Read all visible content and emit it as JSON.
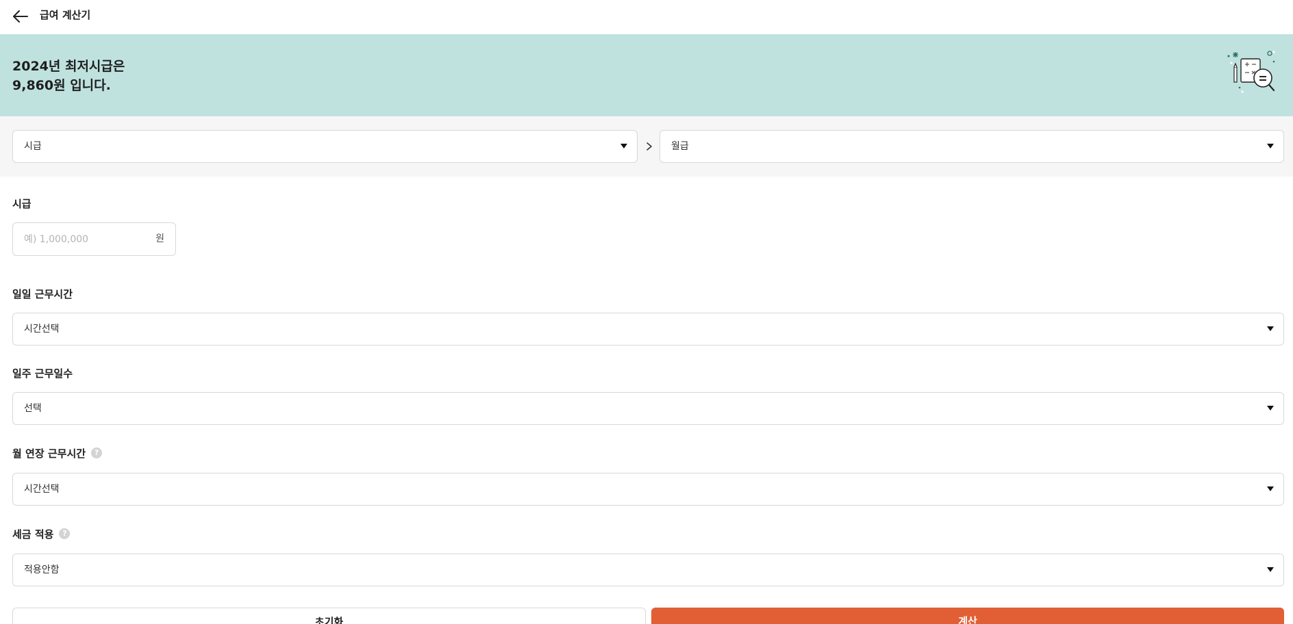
{
  "header": {
    "title": "급여 계산기",
    "back_icon": "arrow-left-icon"
  },
  "banner": {
    "line1": "2024년 최저시급은",
    "line2": "9,860원 입니다.",
    "bg_color": "#bfe2df",
    "illustration_icon": "calculator-magnifier-icon"
  },
  "converter": {
    "from_value": "시급",
    "to_value": "월급",
    "arrow_icon": "chevron-right-icon"
  },
  "wage": {
    "label": "시급",
    "placeholder": "예) 1,000,000",
    "unit": "원"
  },
  "daily_hours": {
    "label": "일일 근무시간",
    "value": "시간선택"
  },
  "weekly_days": {
    "label": "일주 근무일수",
    "value": "선택"
  },
  "overtime": {
    "label": "월 연장 근무시간",
    "value": "시간선택",
    "help_icon": "question-circle-icon"
  },
  "tax": {
    "label": "세금 적용",
    "value": "적용안함",
    "help_icon": "question-circle-icon"
  },
  "actions": {
    "reset_label": "초기화",
    "calc_label": "계산",
    "calc_color": "#e25f36"
  }
}
